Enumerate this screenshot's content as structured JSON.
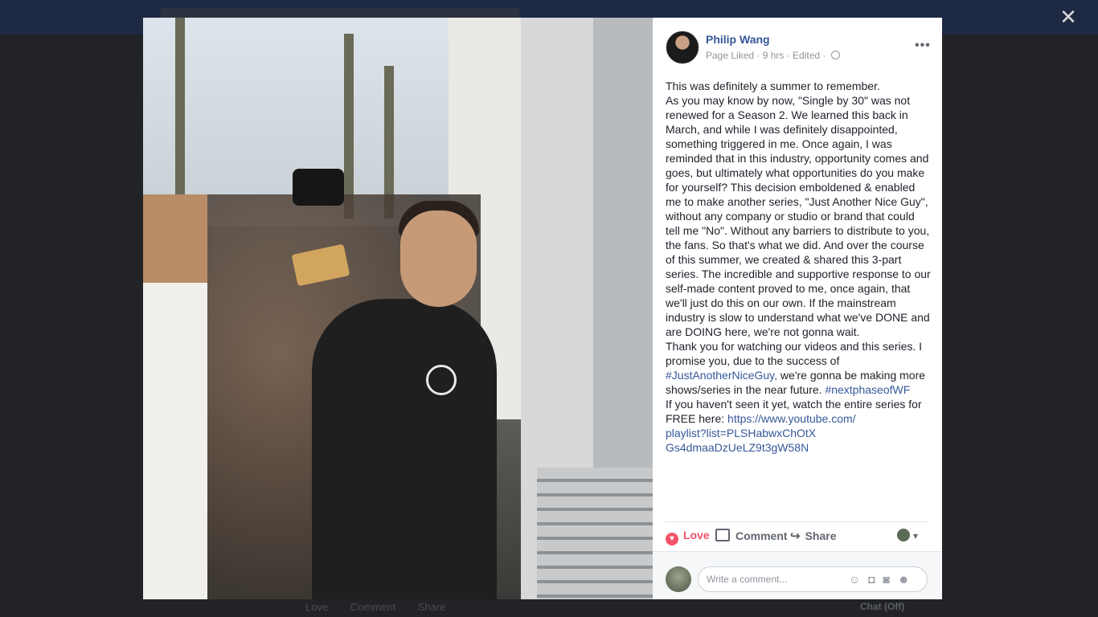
{
  "modal": {
    "close_glyph": "✕"
  },
  "background": {
    "bottom_actions": [
      "Love",
      "Comment",
      "Share"
    ],
    "chat_label": "Chat (Off)"
  },
  "post": {
    "author": "Philip Wang",
    "meta": "Page Liked · 9 hrs · Edited ·",
    "more_glyph": "•••",
    "text_lines": [
      "This was definitely a summer to remember.",
      "As you may know by now, \"Single by 30\" was not renewed for a Season 2. We learned this back in March, and while I was definitely disappointed, something triggered in me. Once again, I was reminded that in this industry, opportunity comes and goes, but ultimately what opportunities do you make for yourself? This decision emboldened & enabled me to make another series, \"Just Another Nice Guy\", without any company or studio or brand that could tell me \"No\". Without any barriers to distribute to you, the fans. So that's what we did. And over the course of this summer, we created & shared this 3-part series. The incredible and supportive response to our self-made content proved to me, once again, that we'll just do this on our own. If the mainstream industry is slow to understand what we've DONE and are DOING here, we're not gonna wait."
    ],
    "thanks_pre": "Thank you for watching our videos and this series. I promise you, due to the success of",
    "hashtag1": "#JustAnotherNiceGuy,",
    "thanks_mid": "we're gonna be making more shows/series in the near future.",
    "hashtag2": "#nextphaseofWF",
    "link_pre": "If you haven't seen it yet, watch the entire series for FREE here:",
    "link_line1": "https://www.youtube.com/",
    "link_line2": "playlist?list=PLSHabwxChOtX",
    "link_line3": "Gs4dmaaDzUeLZ9t3gW58N"
  },
  "actions": {
    "love": "Love",
    "comment": "Comment",
    "share": "Share"
  },
  "comment": {
    "placeholder": "Write a comment..."
  },
  "icons": {
    "heart": "heart-icon",
    "comment": "comment-icon",
    "share": "share-icon",
    "globe": "globe-icon",
    "emoji": "emoji-icon",
    "camera": "camera-icon",
    "gif": "gif-icon",
    "sticker": "sticker-icon"
  },
  "colors": {
    "link": "#365899",
    "love": "#f25268",
    "overlay": "#1c1d1f"
  }
}
